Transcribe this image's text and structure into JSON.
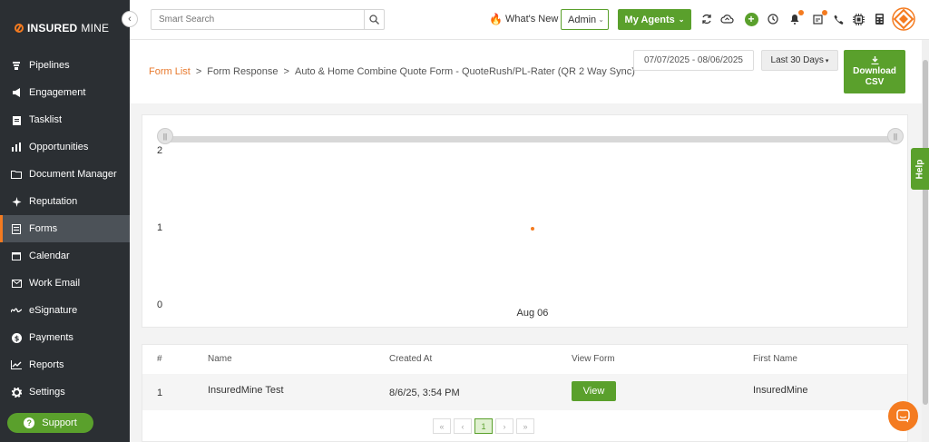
{
  "brand": {
    "part1": "INSURED",
    "part2": "MINE",
    "collapse_icon": "chevron-left-icon"
  },
  "sidebar": {
    "items": [
      {
        "label": "Pipelines",
        "icon": "funnel-icon"
      },
      {
        "label": "Engagement",
        "icon": "megaphone-icon"
      },
      {
        "label": "Tasklist",
        "icon": "clipboard-icon"
      },
      {
        "label": "Opportunities",
        "icon": "bar-chart-icon"
      },
      {
        "label": "Document Manager",
        "icon": "folder-icon"
      },
      {
        "label": "Reputation",
        "icon": "sparkle-icon"
      },
      {
        "label": "Forms",
        "icon": "form-icon",
        "active": true
      },
      {
        "label": "Calendar",
        "icon": "calendar-icon"
      },
      {
        "label": "Work Email",
        "icon": "envelope-icon"
      },
      {
        "label": "eSignature",
        "icon": "signature-icon"
      },
      {
        "label": "Payments",
        "icon": "dollar-icon"
      },
      {
        "label": "Reports",
        "icon": "line-chart-icon"
      },
      {
        "label": "Settings",
        "icon": "gear-icon"
      }
    ],
    "support_label": "Support"
  },
  "topbar": {
    "search_placeholder": "Smart Search",
    "whats_new": "What's New",
    "admin_label": "Admin",
    "my_agents_label": "My Agents"
  },
  "breadcrumb": {
    "form_list": "Form List",
    "form_response": "Form Response",
    "form_name": "Auto & Home Combine Quote Form - QuoteRush/PL-Rater (QR 2 Way Sync)",
    "separator": ">"
  },
  "filters": {
    "date_range": "07/07/2025 - 08/06/2025",
    "period": "Last 30 Days",
    "download_line1": "Download",
    "download_line2": "CSV"
  },
  "chart_data": {
    "type": "scatter",
    "title": "",
    "xlabel": "",
    "ylabel": "",
    "categories": [
      "Aug 06"
    ],
    "values": [
      1
    ],
    "yticks": [
      "2",
      "1",
      "0"
    ],
    "ylim": [
      0,
      2
    ],
    "point_color": "#f47b20"
  },
  "table": {
    "columns": [
      "#",
      "Name",
      "Created At",
      "View Form",
      "First Name"
    ],
    "rows": [
      {
        "index": "1",
        "name": "InsuredMine Test",
        "created_at": "8/6/25, 3:54 PM",
        "view_label": "View",
        "first_name": "InsuredMine"
      }
    ]
  },
  "pagination": {
    "first": "«",
    "prev": "‹",
    "current": "1",
    "next": "›",
    "last": "»"
  },
  "help_label": "Help",
  "colors": {
    "accent_green": "#5aa02c",
    "accent_orange": "#f47b20",
    "sidebar_bg": "#2b2f33"
  }
}
